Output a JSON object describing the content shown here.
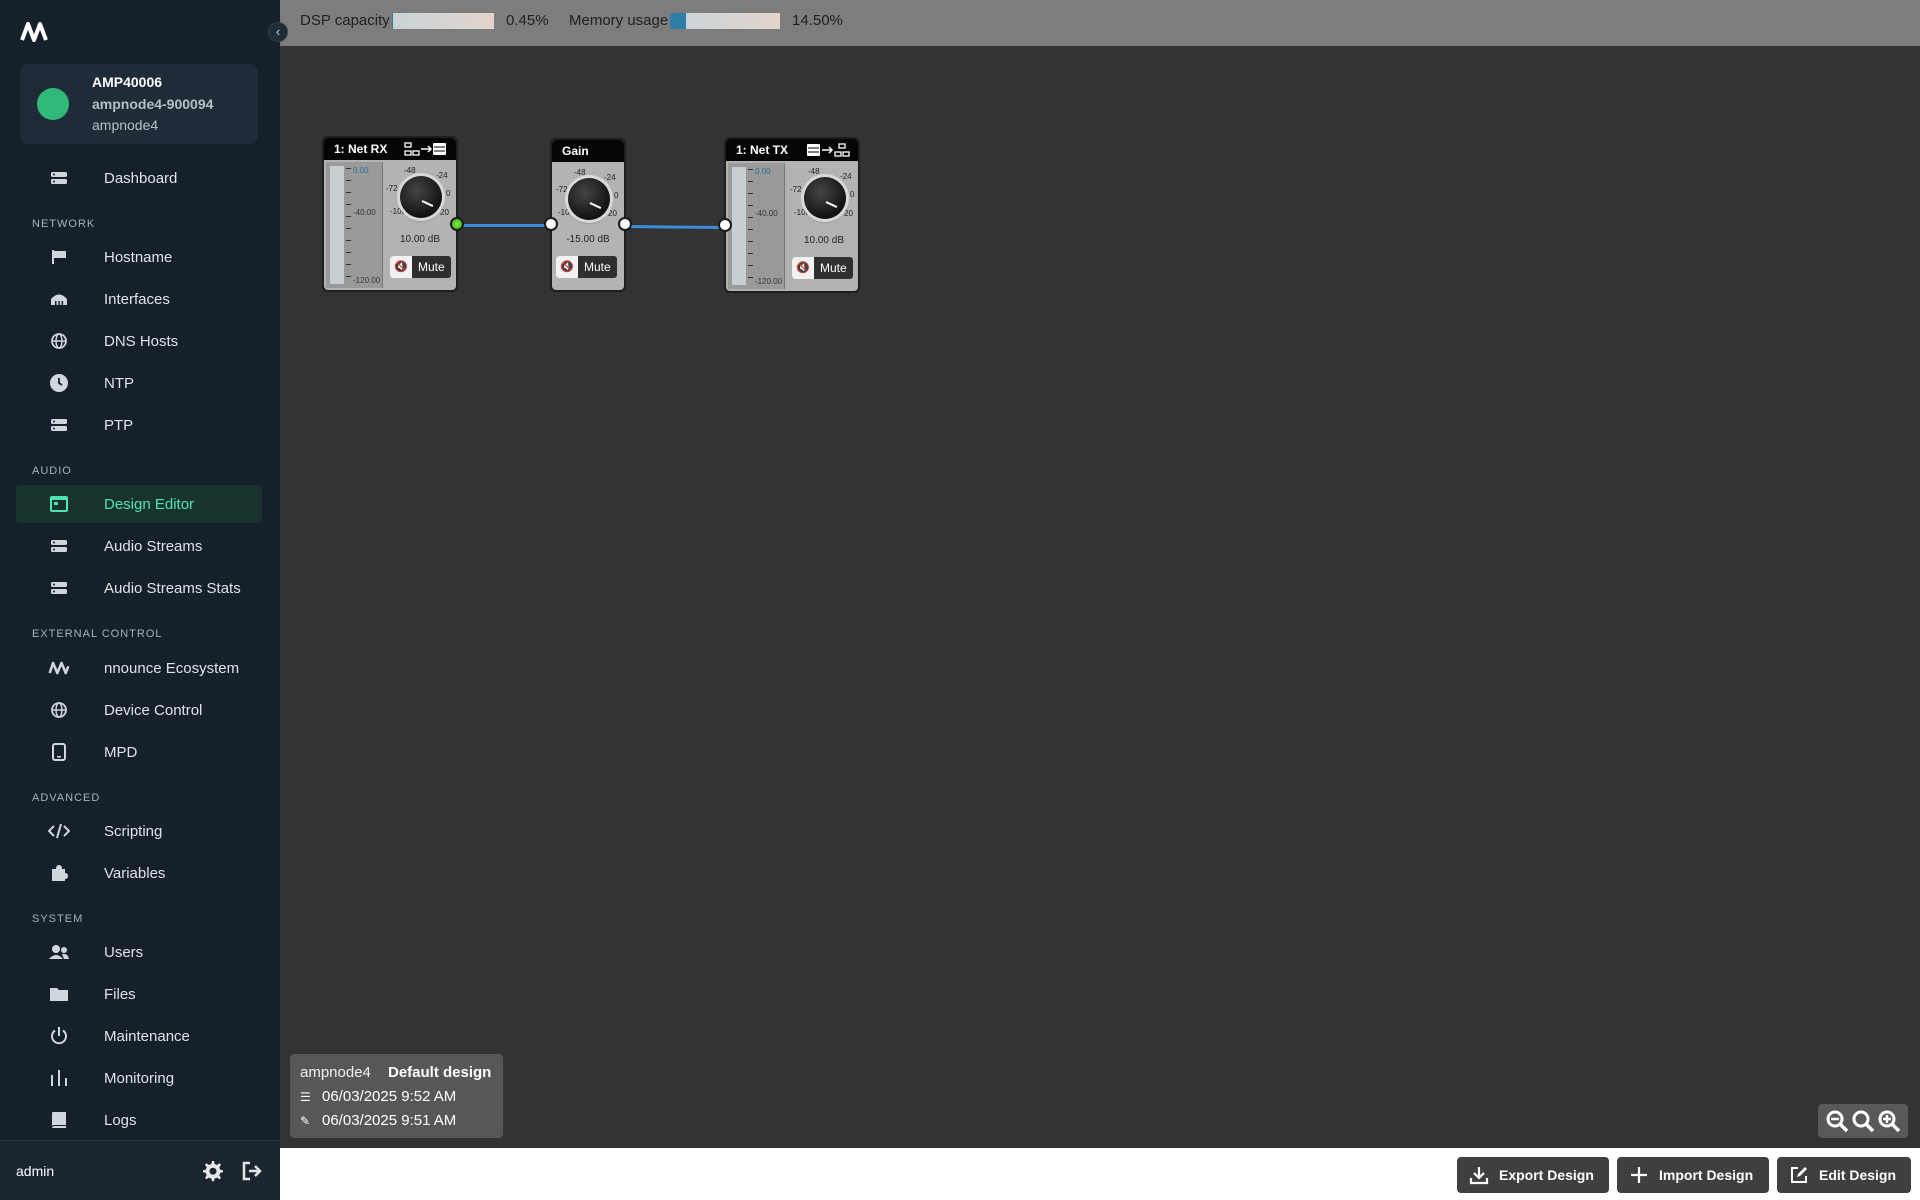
{
  "sidebar": {
    "device": {
      "name": "AMP40006",
      "hostname": "ampnode4-900094",
      "model": "ampnode4",
      "status_color": "#32b87a"
    },
    "items": [
      {
        "label": "Dashboard",
        "icon": "server-icon"
      },
      {
        "label": "Hostname",
        "icon": "flag-icon"
      },
      {
        "label": "Interfaces",
        "icon": "network-icon"
      },
      {
        "label": "DNS Hosts",
        "icon": "globe-icon"
      },
      {
        "label": "NTP",
        "icon": "clock-icon"
      },
      {
        "label": "PTP",
        "icon": "server-icon"
      },
      {
        "label": "Design Editor",
        "icon": "window-icon",
        "active": true
      },
      {
        "label": "Audio Streams",
        "icon": "server-icon"
      },
      {
        "label": "Audio Streams Stats",
        "icon": "server-icon"
      },
      {
        "label": "nnounce Ecosystem",
        "icon": "logo-icon"
      },
      {
        "label": "Device Control",
        "icon": "globe-icon"
      },
      {
        "label": "MPD",
        "icon": "tablet-icon"
      },
      {
        "label": "Scripting",
        "icon": "code-icon"
      },
      {
        "label": "Variables",
        "icon": "puzzle-icon"
      },
      {
        "label": "Users",
        "icon": "users-icon"
      },
      {
        "label": "Files",
        "icon": "folder-icon"
      },
      {
        "label": "Maintenance",
        "icon": "power-icon"
      },
      {
        "label": "Monitoring",
        "icon": "bars-icon"
      },
      {
        "label": "Logs",
        "icon": "book-icon"
      }
    ],
    "sections": {
      "network": "NETWORK",
      "audio": "AUDIO",
      "external": "EXTERNAL CONTROL",
      "advanced": "ADVANCED",
      "system": "SYSTEM"
    },
    "user": "admin",
    "accent": "#4fe3b4"
  },
  "topbar": {
    "dsp_label": "DSP capacity",
    "dsp_value": "0.45%",
    "dsp_fraction": 0.0045,
    "mem_label": "Memory usage",
    "mem_value": "14.50%",
    "mem_fraction": 0.145
  },
  "blocks": {
    "netrx": {
      "title": "1: Net RX",
      "meter_top": "0.00",
      "meter_mid": "-40.00",
      "meter_bot": "-120.00",
      "knob_labels": [
        "-48",
        "-24",
        "-72",
        "0",
        "-100",
        "20"
      ],
      "db": "10.00 dB",
      "mute": "Mute"
    },
    "gain": {
      "title": "Gain",
      "knob_labels": [
        "-48",
        "-24",
        "-72",
        "0",
        "-100",
        "20"
      ],
      "db": "-15.00 dB",
      "mute": "Mute"
    },
    "nettx": {
      "title": "1: Net TX",
      "meter_top": "0.00",
      "meter_mid": "-40.00",
      "meter_bot": "-120.00",
      "knob_labels": [
        "-48",
        "-24",
        "-72",
        "0",
        "-100",
        "20"
      ],
      "db": "10.00 dB",
      "mute": "Mute"
    }
  },
  "design_info": {
    "host": "ampnode4",
    "name": "Default design",
    "modified": "06/03/2025 9:52 AM",
    "created": "06/03/2025 9:51 AM"
  },
  "bottom": {
    "export": "Export Design",
    "import": "Import Design",
    "edit": "Edit Design"
  }
}
